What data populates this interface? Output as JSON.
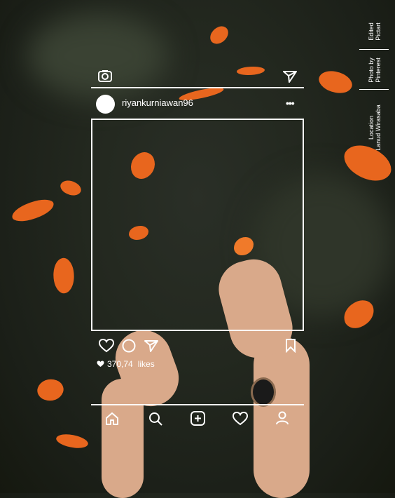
{
  "credits": {
    "edited": [
      "Edited",
      "Pictart"
    ],
    "photo": [
      "Photo by",
      "Pinterest"
    ],
    "location": [
      "Location",
      "Lanud Wirasaba"
    ]
  },
  "post": {
    "username": "riyankurniawan96",
    "likes": "370,74",
    "likes_label": "likes"
  },
  "colors": {
    "butterfly": "#e8661e",
    "background": "#23281f",
    "frame": "#ffffff"
  }
}
